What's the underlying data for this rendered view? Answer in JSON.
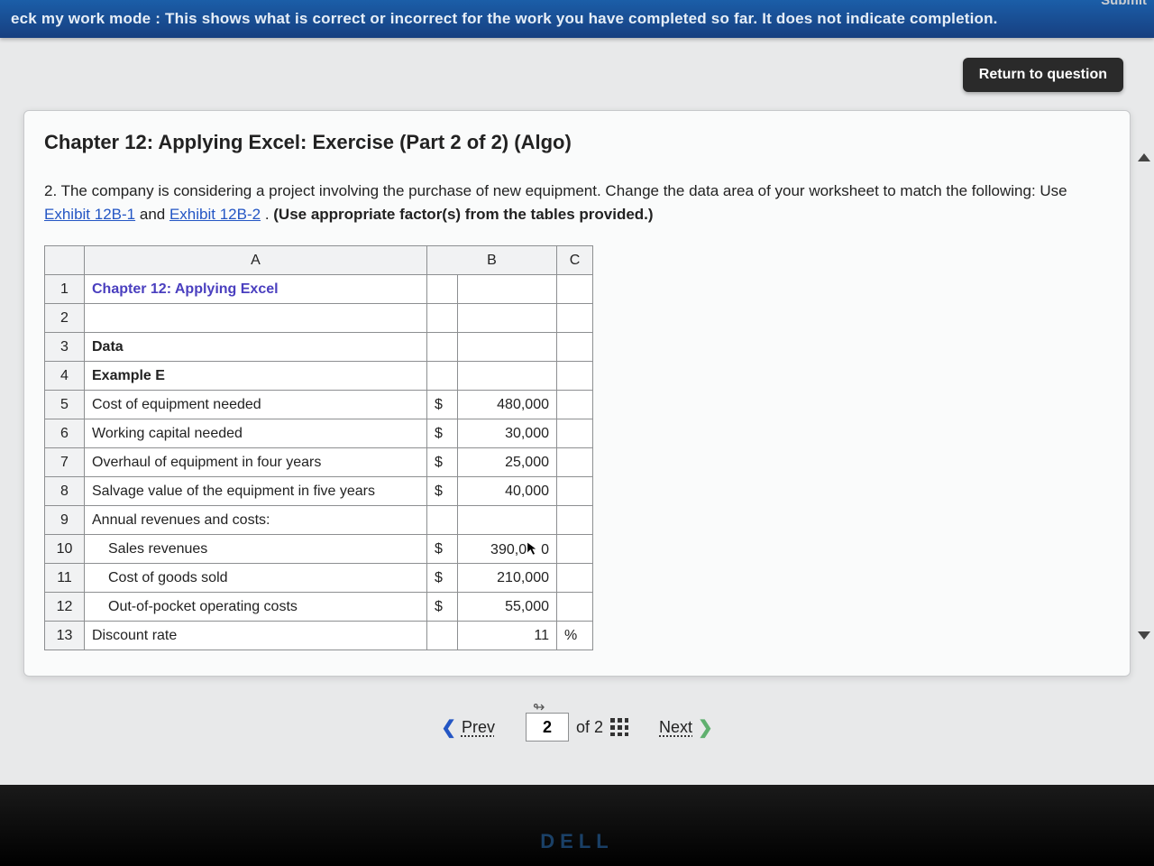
{
  "banner": {
    "text": "eck my work mode : This shows what is correct or incorrect for the work you have completed so far. It does not indicate completion."
  },
  "topright_fragment": "Submit",
  "return_button": "Return to question",
  "title": "Chapter 12: Applying Excel: Exercise (Part 2 of 2) (Algo)",
  "question": {
    "lead": "2. The company is considering a project involving the purchase of new equipment. Change the data area of your worksheet to match the following: Use ",
    "link1": "Exhibit 12B-1",
    "mid": " and ",
    "link2": "Exhibit 12B-2",
    "tail_bold": "(Use appropriate factor(s) from the tables provided.)",
    "period": ". "
  },
  "sheet": {
    "headers": {
      "A": "A",
      "B": "B",
      "C": "C"
    },
    "rows": [
      {
        "n": "1",
        "a": "Chapter 12: Applying Excel",
        "a_class": "chapter-cell",
        "sym": "",
        "b": "",
        "c": ""
      },
      {
        "n": "2",
        "a": "",
        "sym": "",
        "b": "",
        "c": ""
      },
      {
        "n": "3",
        "a": "Data",
        "a_class": "bold-cell",
        "sym": "",
        "b": "",
        "c": ""
      },
      {
        "n": "4",
        "a": "Example E",
        "a_class": "bold-cell",
        "sym": "",
        "b": "",
        "c": ""
      },
      {
        "n": "5",
        "a": "Cost of equipment needed",
        "sym": "$",
        "b": "480,000",
        "c": ""
      },
      {
        "n": "6",
        "a": "Working capital needed",
        "sym": "$",
        "b": "30,000",
        "c": ""
      },
      {
        "n": "7",
        "a": "Overhaul of equipment in four years",
        "sym": "$",
        "b": "25,000",
        "c": ""
      },
      {
        "n": "8",
        "a": "Salvage value of the equipment in five years",
        "sym": "$",
        "b": "40,000",
        "c": ""
      },
      {
        "n": "9",
        "a": "Annual revenues and costs:",
        "sym": "",
        "b": "",
        "c": ""
      },
      {
        "n": "10",
        "a": "Sales revenues",
        "a_indent": true,
        "sym": "$",
        "b": "390,000",
        "c": "",
        "cursor": true
      },
      {
        "n": "11",
        "a": "Cost of goods sold",
        "a_indent": true,
        "sym": "$",
        "b": "210,000",
        "c": ""
      },
      {
        "n": "12",
        "a": "Out-of-pocket operating costs",
        "a_indent": true,
        "sym": "$",
        "b": "55,000",
        "c": ""
      },
      {
        "n": "13",
        "a": "Discount rate",
        "sym": "",
        "b": "11",
        "c": "%"
      }
    ]
  },
  "nav": {
    "prev": "Prev",
    "page_value": "2",
    "of_text": "of 2",
    "next": "Next",
    "linked_glyph": "↬"
  },
  "brand": "DELL"
}
